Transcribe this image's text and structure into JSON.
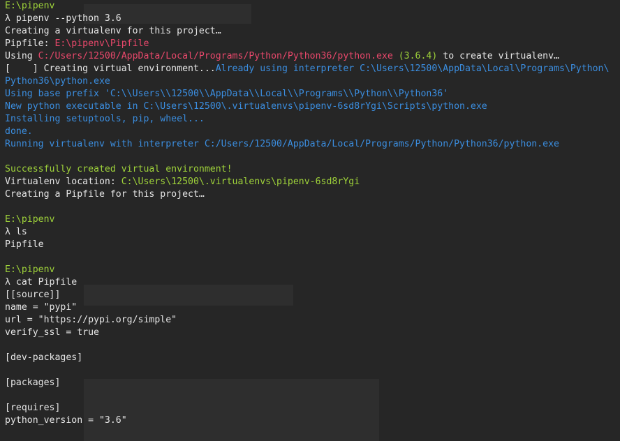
{
  "terminal": {
    "colors": {
      "green": "#9fd33a",
      "red": "#e8486b",
      "blue": "#3b8ee0",
      "white": "#e6e6e6",
      "background": "#262626"
    },
    "lines": [
      [
        {
          "c": "green",
          "t": "E:\\pipenv"
        }
      ],
      [
        {
          "c": "white",
          "t": "λ pipenv --python 3.6"
        }
      ],
      [
        {
          "c": "white",
          "t": "Creating a virtualenv for this project…"
        }
      ],
      [
        {
          "c": "white",
          "t": "Pipfile: "
        },
        {
          "c": "red",
          "t": "E:\\pipenv\\Pipfile"
        }
      ],
      [
        {
          "c": "white",
          "t": "Using "
        },
        {
          "c": "red",
          "t": "C:/Users/12500/AppData/Local/Programs/Python/Python36/python.exe"
        },
        {
          "c": "green",
          "t": " (3.6.4)"
        },
        {
          "c": "white",
          "t": " to create virtualenv…"
        }
      ],
      [
        {
          "c": "white",
          "t": "[    ] Creating virtual environment..."
        },
        {
          "c": "blue",
          "t": "Already using interpreter C:\\Users\\12500\\AppData\\Local\\Programs\\Python\\"
        }
      ],
      [
        {
          "c": "blue",
          "t": "Python36\\python.exe"
        }
      ],
      [
        {
          "c": "blue",
          "t": "Using base prefix 'C:\\\\Users\\\\12500\\\\AppData\\\\Local\\\\Programs\\\\Python\\\\Python36'"
        }
      ],
      [
        {
          "c": "blue",
          "t": "New python executable in C:\\Users\\12500\\.virtualenvs\\pipenv-6sd8rYgi\\Scripts\\python.exe"
        }
      ],
      [
        {
          "c": "blue",
          "t": "Installing setuptools, pip, wheel..."
        }
      ],
      [
        {
          "c": "blue",
          "t": "done."
        }
      ],
      [
        {
          "c": "blue",
          "t": "Running virtualenv with interpreter C:/Users/12500/AppData/Local/Programs/Python/Python36/python.exe"
        }
      ],
      [],
      [
        {
          "c": "green",
          "t": "Successfully created virtual environment!"
        }
      ],
      [
        {
          "c": "white",
          "t": "Virtualenv location: "
        },
        {
          "c": "green",
          "t": "C:\\Users\\12500\\.virtualenvs\\pipenv-6sd8rYgi"
        }
      ],
      [
        {
          "c": "white",
          "t": "Creating a Pipfile for this project…"
        }
      ],
      [],
      [
        {
          "c": "green",
          "t": "E:\\pipenv"
        }
      ],
      [
        {
          "c": "white",
          "t": "λ ls"
        }
      ],
      [
        {
          "c": "white",
          "t": "Pipfile"
        }
      ],
      [],
      [
        {
          "c": "green",
          "t": "E:\\pipenv"
        }
      ],
      [
        {
          "c": "white",
          "t": "λ cat Pipfile"
        }
      ],
      [
        {
          "c": "white",
          "t": "[[source]]"
        }
      ],
      [
        {
          "c": "white",
          "t": "name = \"pypi\""
        }
      ],
      [
        {
          "c": "white",
          "t": "url = \"https://pypi.org/simple\""
        }
      ],
      [
        {
          "c": "white",
          "t": "verify_ssl = true"
        }
      ],
      [],
      [
        {
          "c": "white",
          "t": "[dev-packages]"
        }
      ],
      [],
      [
        {
          "c": "white",
          "t": "[packages]"
        }
      ],
      [],
      [
        {
          "c": "white",
          "t": "[requires]"
        }
      ],
      [
        {
          "c": "white",
          "t": "python_version = \"3.6\""
        }
      ]
    ]
  }
}
